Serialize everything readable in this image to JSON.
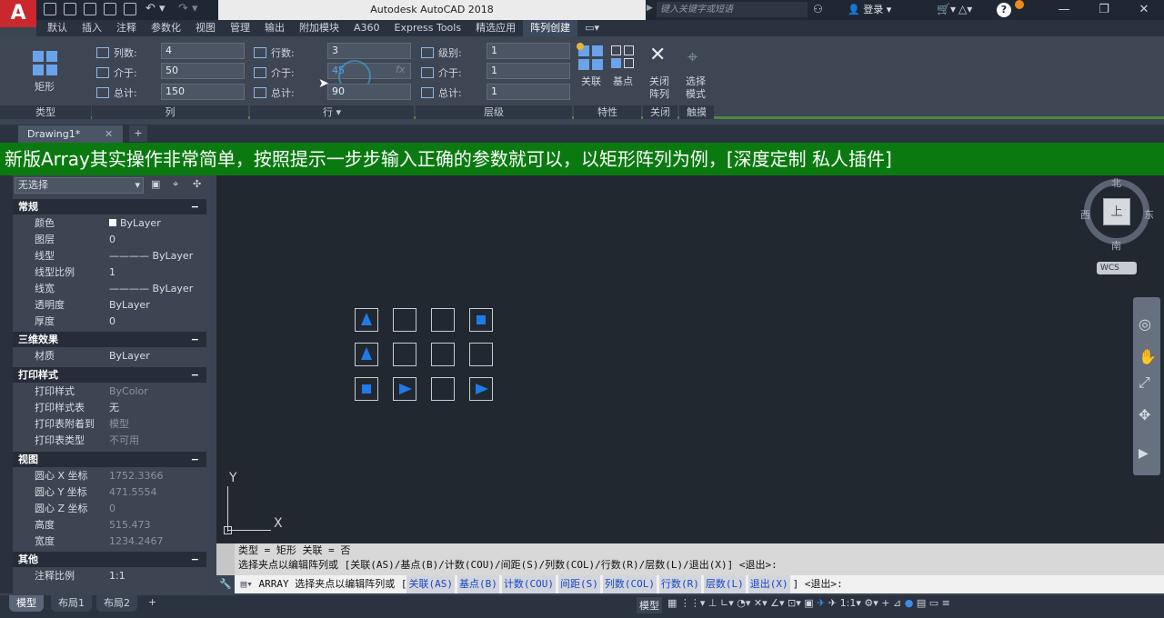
{
  "app": {
    "logo": "A",
    "title": "Autodesk AutoCAD 2018",
    "search_placeholder": "键入关键字或短语",
    "login": "登录",
    "win_min": "—",
    "win_max": "❐",
    "win_close": "✕"
  },
  "ribbon_tabs": [
    "默认",
    "插入",
    "注释",
    "参数化",
    "视图",
    "管理",
    "输出",
    "附加模块",
    "A360",
    "Express Tools",
    "精选应用",
    "阵列创建"
  ],
  "ribbon": {
    "type_label": "矩形",
    "type_panel": "类型",
    "col": {
      "count_label": "列数:",
      "count": "4",
      "between_label": "介于:",
      "between": "50",
      "total_label": "总计:",
      "total": "150",
      "panel": "列"
    },
    "row": {
      "count_label": "行数:",
      "count": "3",
      "between_label": "介于:",
      "between": "45",
      "total_label": "总计:",
      "total": "90",
      "panel": "行 ▾"
    },
    "level": {
      "count_label": "级别:",
      "count": "1",
      "between_label": "介于:",
      "between": "1",
      "total_label": "总计:",
      "total": "1",
      "panel": "层级"
    },
    "assoc": "关联",
    "base": "基点",
    "props_panel": "特性",
    "close_line1": "关闭",
    "close_line2": "阵列",
    "close_panel": "关闭",
    "grip_line1": "选择",
    "grip_line2": "模式",
    "grip_panel": "触摸"
  },
  "doc_tab": "Drawing1*",
  "doc_tab_close": "✕",
  "doc_tab_add": "+",
  "banner": "新版Array其实操作非常简单，按照提示一步步输入正确的参数就可以，以矩形阵列为例，[深度定制 私人插件]",
  "props": {
    "selector": "无选择",
    "sections": {
      "general": "常规",
      "threed": "三维效果",
      "plot": "打印样式",
      "view": "视图",
      "misc": "其他"
    },
    "general": [
      [
        "颜色",
        "ByLayer"
      ],
      [
        "图层",
        "0"
      ],
      [
        "线型",
        "———— ByLayer"
      ],
      [
        "线型比例",
        "1"
      ],
      [
        "线宽",
        "———— ByLayer"
      ],
      [
        "透明度",
        "ByLayer"
      ],
      [
        "厚度",
        "0"
      ]
    ],
    "threed": [
      [
        "材质",
        "ByLayer"
      ]
    ],
    "plot": [
      [
        "打印样式",
        "ByColor"
      ],
      [
        "打印样式表",
        "无"
      ],
      [
        "打印表附着到",
        "模型"
      ],
      [
        "打印表类型",
        "不可用"
      ]
    ],
    "view": [
      [
        "圆心 X 坐标",
        "1752.3366"
      ],
      [
        "圆心 Y 坐标",
        "471.5554"
      ],
      [
        "圆心 Z 坐标",
        "0"
      ],
      [
        "高度",
        "515.473"
      ],
      [
        "宽度",
        "1234.2467"
      ]
    ],
    "misc": [
      [
        "注释比例",
        "1:1"
      ]
    ],
    "collapse": "−"
  },
  "viewcube": {
    "north": "北",
    "south": "南",
    "east": "东",
    "west": "西",
    "top": "上",
    "wcs": "WCS"
  },
  "ucs": {
    "y": "Y",
    "x": "X"
  },
  "cmd": {
    "hist1": "类型 = 矩形  关联 = 否",
    "hist2": "选择夹点以编辑阵列或 [关联(AS)/基点(B)/计数(COU)/间距(S)/列数(COL)/行数(R)/层数(L)/退出(X)] <退出>:",
    "prompt": "ARRAY 选择夹点以编辑阵列或 [",
    "options": [
      "关联(AS)",
      "基点(B)",
      "计数(COU)",
      "间距(S)",
      "列数(COL)",
      "行数(R)",
      "层数(L)",
      "退出(X)"
    ],
    "tail": "] <退出>:"
  },
  "status": {
    "tabs": [
      "模型",
      "布局1",
      "布局2"
    ],
    "add": "+",
    "model": "模型",
    "scale": "1:1"
  },
  "colors": {
    "accent_blue": "#1f7be6",
    "banner_green": "#0a7a10",
    "logo_red": "#c8282e"
  }
}
